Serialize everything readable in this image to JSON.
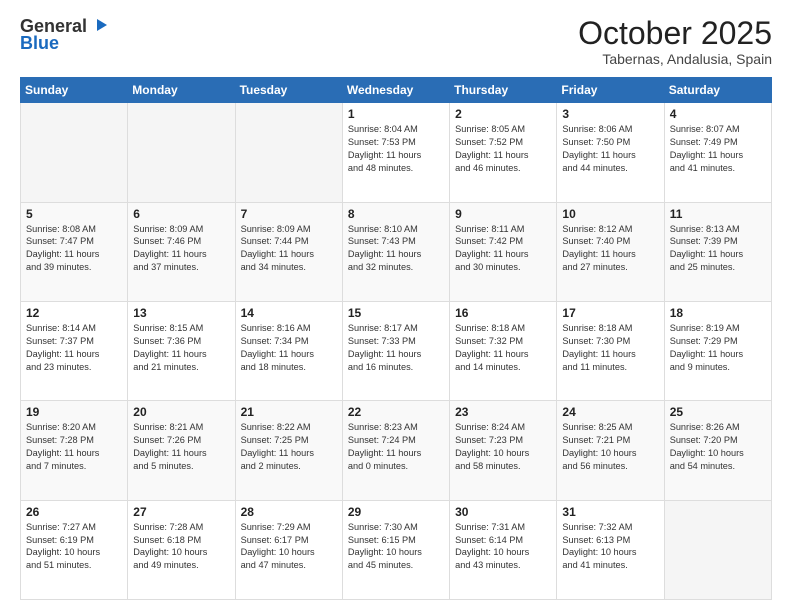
{
  "header": {
    "logo_general": "General",
    "logo_blue": "Blue",
    "month_title": "October 2025",
    "location": "Tabernas, Andalusia, Spain"
  },
  "days_of_week": [
    "Sunday",
    "Monday",
    "Tuesday",
    "Wednesday",
    "Thursday",
    "Friday",
    "Saturday"
  ],
  "weeks": [
    [
      {
        "day": "",
        "info": ""
      },
      {
        "day": "",
        "info": ""
      },
      {
        "day": "",
        "info": ""
      },
      {
        "day": "1",
        "info": "Sunrise: 8:04 AM\nSunset: 7:53 PM\nDaylight: 11 hours\nand 48 minutes."
      },
      {
        "day": "2",
        "info": "Sunrise: 8:05 AM\nSunset: 7:52 PM\nDaylight: 11 hours\nand 46 minutes."
      },
      {
        "day": "3",
        "info": "Sunrise: 8:06 AM\nSunset: 7:50 PM\nDaylight: 11 hours\nand 44 minutes."
      },
      {
        "day": "4",
        "info": "Sunrise: 8:07 AM\nSunset: 7:49 PM\nDaylight: 11 hours\nand 41 minutes."
      }
    ],
    [
      {
        "day": "5",
        "info": "Sunrise: 8:08 AM\nSunset: 7:47 PM\nDaylight: 11 hours\nand 39 minutes."
      },
      {
        "day": "6",
        "info": "Sunrise: 8:09 AM\nSunset: 7:46 PM\nDaylight: 11 hours\nand 37 minutes."
      },
      {
        "day": "7",
        "info": "Sunrise: 8:09 AM\nSunset: 7:44 PM\nDaylight: 11 hours\nand 34 minutes."
      },
      {
        "day": "8",
        "info": "Sunrise: 8:10 AM\nSunset: 7:43 PM\nDaylight: 11 hours\nand 32 minutes."
      },
      {
        "day": "9",
        "info": "Sunrise: 8:11 AM\nSunset: 7:42 PM\nDaylight: 11 hours\nand 30 minutes."
      },
      {
        "day": "10",
        "info": "Sunrise: 8:12 AM\nSunset: 7:40 PM\nDaylight: 11 hours\nand 27 minutes."
      },
      {
        "day": "11",
        "info": "Sunrise: 8:13 AM\nSunset: 7:39 PM\nDaylight: 11 hours\nand 25 minutes."
      }
    ],
    [
      {
        "day": "12",
        "info": "Sunrise: 8:14 AM\nSunset: 7:37 PM\nDaylight: 11 hours\nand 23 minutes."
      },
      {
        "day": "13",
        "info": "Sunrise: 8:15 AM\nSunset: 7:36 PM\nDaylight: 11 hours\nand 21 minutes."
      },
      {
        "day": "14",
        "info": "Sunrise: 8:16 AM\nSunset: 7:34 PM\nDaylight: 11 hours\nand 18 minutes."
      },
      {
        "day": "15",
        "info": "Sunrise: 8:17 AM\nSunset: 7:33 PM\nDaylight: 11 hours\nand 16 minutes."
      },
      {
        "day": "16",
        "info": "Sunrise: 8:18 AM\nSunset: 7:32 PM\nDaylight: 11 hours\nand 14 minutes."
      },
      {
        "day": "17",
        "info": "Sunrise: 8:18 AM\nSunset: 7:30 PM\nDaylight: 11 hours\nand 11 minutes."
      },
      {
        "day": "18",
        "info": "Sunrise: 8:19 AM\nSunset: 7:29 PM\nDaylight: 11 hours\nand 9 minutes."
      }
    ],
    [
      {
        "day": "19",
        "info": "Sunrise: 8:20 AM\nSunset: 7:28 PM\nDaylight: 11 hours\nand 7 minutes."
      },
      {
        "day": "20",
        "info": "Sunrise: 8:21 AM\nSunset: 7:26 PM\nDaylight: 11 hours\nand 5 minutes."
      },
      {
        "day": "21",
        "info": "Sunrise: 8:22 AM\nSunset: 7:25 PM\nDaylight: 11 hours\nand 2 minutes."
      },
      {
        "day": "22",
        "info": "Sunrise: 8:23 AM\nSunset: 7:24 PM\nDaylight: 11 hours\nand 0 minutes."
      },
      {
        "day": "23",
        "info": "Sunrise: 8:24 AM\nSunset: 7:23 PM\nDaylight: 10 hours\nand 58 minutes."
      },
      {
        "day": "24",
        "info": "Sunrise: 8:25 AM\nSunset: 7:21 PM\nDaylight: 10 hours\nand 56 minutes."
      },
      {
        "day": "25",
        "info": "Sunrise: 8:26 AM\nSunset: 7:20 PM\nDaylight: 10 hours\nand 54 minutes."
      }
    ],
    [
      {
        "day": "26",
        "info": "Sunrise: 7:27 AM\nSunset: 6:19 PM\nDaylight: 10 hours\nand 51 minutes."
      },
      {
        "day": "27",
        "info": "Sunrise: 7:28 AM\nSunset: 6:18 PM\nDaylight: 10 hours\nand 49 minutes."
      },
      {
        "day": "28",
        "info": "Sunrise: 7:29 AM\nSunset: 6:17 PM\nDaylight: 10 hours\nand 47 minutes."
      },
      {
        "day": "29",
        "info": "Sunrise: 7:30 AM\nSunset: 6:15 PM\nDaylight: 10 hours\nand 45 minutes."
      },
      {
        "day": "30",
        "info": "Sunrise: 7:31 AM\nSunset: 6:14 PM\nDaylight: 10 hours\nand 43 minutes."
      },
      {
        "day": "31",
        "info": "Sunrise: 7:32 AM\nSunset: 6:13 PM\nDaylight: 10 hours\nand 41 minutes."
      },
      {
        "day": "",
        "info": ""
      }
    ]
  ]
}
